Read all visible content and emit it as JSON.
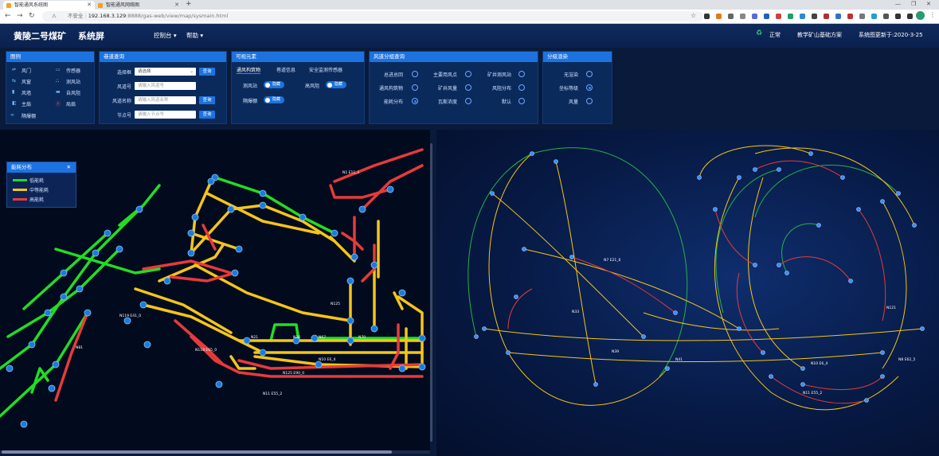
{
  "browser": {
    "tabs": [
      {
        "title": "智能通风系统图"
      },
      {
        "title": "智能通风网络图"
      }
    ],
    "new_tab": "+",
    "url_security": "不安全",
    "url_host": "192.168.3.129",
    "url_path": ":8888/gas-web/view/map/sysmain.html"
  },
  "header": {
    "mine_name": "黄陵二号煤矿",
    "screen_name": "系统屏",
    "menus": [
      "控制台 ▾",
      "帮助 ▾"
    ],
    "status": "正常",
    "scheme": "教学矿山基础方案",
    "updated": "系统图更新于:2020-3-25"
  },
  "panels": {
    "legend": {
      "title": "图例",
      "items": [
        {
          "icon": "air-door-icon",
          "label": "风门"
        },
        {
          "icon": "sensor-icon",
          "label": "传感器"
        },
        {
          "icon": "wind-window-icon",
          "label": "风窗"
        },
        {
          "icon": "wind-station-icon",
          "label": "测风站"
        },
        {
          "icon": "wind-wall-icon",
          "label": "风墙"
        },
        {
          "icon": "damper-icon",
          "label": "自风阻"
        },
        {
          "icon": "main-fan-icon",
          "label": "主扇"
        },
        {
          "icon": "local-fan-icon",
          "label": "局扇"
        },
        {
          "icon": "barrier-icon",
          "label": "隔爆棚"
        }
      ]
    },
    "airway_query": {
      "title": "巷道查询",
      "rows": [
        {
          "label": "选择框",
          "placeholder": "请选择",
          "button": "查询"
        },
        {
          "label": "风道号",
          "placeholder": "请输入风道号",
          "button": "查询"
        },
        {
          "label": "风道名称",
          "placeholder": "请输入风道名称",
          "button": "查询"
        },
        {
          "label": "节点号",
          "placeholder": "请输入节点号",
          "button": "查询"
        }
      ]
    },
    "visual": {
      "title": "可视元素",
      "tabs": [
        "通风构筑物",
        "巷道信息",
        "安全监测传感器"
      ],
      "toggles": [
        {
          "label": "测风站",
          "state": "隐藏"
        },
        {
          "label": "高风阻",
          "state": "隐藏"
        },
        {
          "label": "隔爆棚",
          "state": "隐藏"
        }
      ]
    },
    "zone_query": {
      "title": "风道分组查询",
      "options": [
        {
          "label": "总进总回",
          "on": false
        },
        {
          "label": "主要用风点",
          "on": false
        },
        {
          "label": "矿井测风站",
          "on": false
        },
        {
          "label": "通风构筑物",
          "on": false
        },
        {
          "label": "矿井风量",
          "on": false
        },
        {
          "label": "风阻分布",
          "on": false
        },
        {
          "label": "能耗分布",
          "on": true
        },
        {
          "label": "瓦斯浓度",
          "on": false
        },
        {
          "label": "默认",
          "on": false
        }
      ]
    },
    "render": {
      "title": "分级渲染",
      "options": [
        {
          "label": "无渲染",
          "on": false
        },
        {
          "label": "坐标等级",
          "on": true
        },
        {
          "label": "风量",
          "on": false
        }
      ]
    }
  },
  "energy_legend": {
    "title": "能耗分布",
    "close": "✕",
    "items": [
      {
        "label": "低能耗",
        "color": "#22dd22"
      },
      {
        "label": "中等能耗",
        "color": "#f5c518"
      },
      {
        "label": "高能耗",
        "color": "#e83a3a"
      }
    ]
  },
  "map_labels": {
    "n1": "N1 E11_1",
    "n2": "N10 E6_4",
    "n3": "N125 E90_0",
    "n4": "N11 E55_2",
    "n5": "N119 E41_0",
    "n6": "N118 E65_0",
    "n7": "N70",
    "n8": "N67",
    "n9": "N26",
    "n10": "N21",
    "n11": "N125",
    "n12": "N81"
  },
  "network_labels": {
    "r1": "N7 E21_6",
    "r2": "N41",
    "r3": "N10 E6_4",
    "r4": "N11 E55_2",
    "r5": "N121",
    "r6": "N8 E62_5",
    "r7": "N39",
    "r8": "N33"
  }
}
